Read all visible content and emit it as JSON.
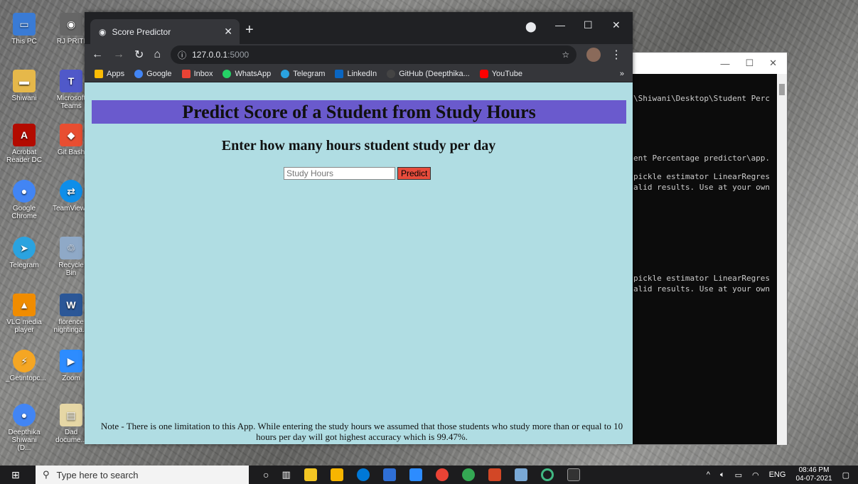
{
  "desktop": {
    "icons_left": [
      {
        "label": "This PC",
        "color": "#3a7bd5"
      },
      {
        "label": "Shiwani",
        "color": "#e6b84a"
      },
      {
        "label": "Acrobat Reader DC",
        "color": "#b30b00"
      },
      {
        "label": "Google Chrome",
        "color": "#4285f4"
      },
      {
        "label": "Telegram",
        "color": "#2aa3e0"
      },
      {
        "label": "VLC media player",
        "color": "#f08c00"
      },
      {
        "label": "_Getintopc...",
        "color": "#f5a623"
      },
      {
        "label": "Deepthika Shiwani (D...",
        "color": "#4285f4"
      }
    ],
    "icons_right": [
      {
        "label": "RJ PRITI",
        "color": "#666666"
      },
      {
        "label": "Microsoft Teams",
        "color": "#5059c9"
      },
      {
        "label": "Git Bash",
        "color": "#e84e31"
      },
      {
        "label": "TeamViewer",
        "color": "#0e8ee9"
      },
      {
        "label": "Recycle Bin",
        "color": "#8fa9c7"
      },
      {
        "label": "florence nightinga...",
        "color": "#2b5797"
      },
      {
        "label": "Zoom",
        "color": "#2d8cff"
      },
      {
        "label": "Dad docume...",
        "color": "#e6d7a5"
      }
    ]
  },
  "console": {
    "lines": [
      "\\Shiwani\\Desktop\\Student Perc",
      "ent Percentage predictor\\app.",
      "pickle estimator LinearRegres",
      "alid results. Use at your own",
      "pickle estimator LinearRegres",
      "alid results. Use at your own"
    ]
  },
  "browser": {
    "tab_title": "Score Predictor",
    "url_host": "127.0.0.1",
    "url_port": ":5000",
    "bookmarks": [
      {
        "label": "Apps",
        "color": "#fbbc05"
      },
      {
        "label": "Google",
        "color": "#4285f4"
      },
      {
        "label": "Inbox",
        "color": "#ea4335"
      },
      {
        "label": "WhatsApp",
        "color": "#25d366"
      },
      {
        "label": "Telegram",
        "color": "#2aa3e0"
      },
      {
        "label": "LinkedIn",
        "color": "#0a66c2"
      },
      {
        "label": "GitHub (Deepthika...",
        "color": "#444444"
      },
      {
        "label": "YouTube",
        "color": "#ff0000"
      }
    ],
    "overflow": "»"
  },
  "page": {
    "banner": "Predict Score of a Student from Study Hours",
    "subheading": "Enter how many hours student study per day",
    "input_placeholder": "Study Hours",
    "button_label": "Predict",
    "note": "Note - There is one limitation to this App. While entering the study hours we assumed that those students who study more than or equal to 10 hours per day will got highest accuracy which is 99.47%."
  },
  "taskbar": {
    "search_placeholder": "Type here to search",
    "lang": "ENG",
    "time": "08:46 PM",
    "date": "04-07-2021"
  }
}
